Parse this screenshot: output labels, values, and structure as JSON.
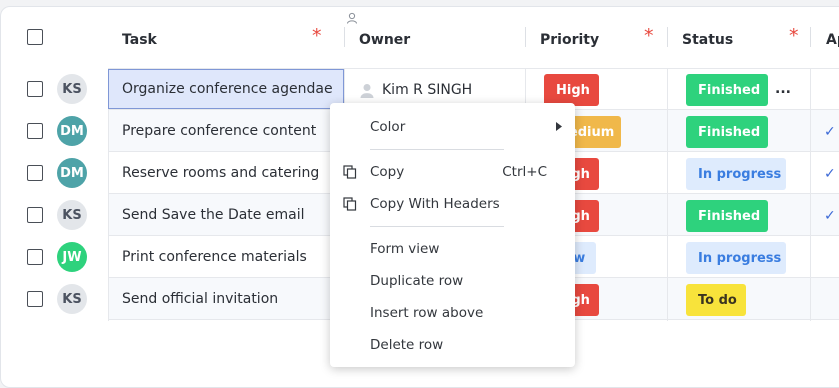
{
  "header": {
    "task": "Task",
    "owner": "Owner",
    "priority": "Priority",
    "status": "Status",
    "approved_partial": "Ap"
  },
  "rows": [
    {
      "initials": "KS",
      "avatar_bg": "#e3e6ea",
      "avatar_fg": "#4b5260",
      "task": "Organize conference agendae",
      "owner": "Kim R SINGH",
      "priority": "High",
      "priority_bg": "#e8493f",
      "priority_fg": "#ffffff",
      "status": "Finished",
      "status_bg": "#2ed27d",
      "status_fg": "#ffffff",
      "check": ""
    },
    {
      "initials": "DM",
      "avatar_bg": "#4ea3a8",
      "avatar_fg": "#ffffff",
      "task": "Prepare conference content",
      "owner": "",
      "priority": "Medium",
      "priority_bg": "#f0b84a",
      "priority_fg": "#ffffff",
      "status": "Finished",
      "status_bg": "#2ed27d",
      "status_fg": "#ffffff",
      "check": "✓"
    },
    {
      "initials": "DM",
      "avatar_bg": "#4ea3a8",
      "avatar_fg": "#ffffff",
      "task": "Reserve rooms and catering",
      "owner": "",
      "priority": "High",
      "priority_bg": "#e8493f",
      "priority_fg": "#ffffff",
      "status": "In progress",
      "status_bg": "#deebfd",
      "status_fg": "#3a7de0",
      "check": "✓"
    },
    {
      "initials": "KS",
      "avatar_bg": "#e3e6ea",
      "avatar_fg": "#4b5260",
      "task": "Send Save the Date email",
      "owner": "",
      "priority": "High",
      "priority_bg": "#e8493f",
      "priority_fg": "#ffffff",
      "status": "Finished",
      "status_bg": "#2ed27d",
      "status_fg": "#ffffff",
      "check": "✓"
    },
    {
      "initials": "JW",
      "avatar_bg": "#2ed27d",
      "avatar_fg": "#ffffff",
      "task": "Print conference materials",
      "owner": "",
      "priority": "Low",
      "priority_bg": "#deebfd",
      "priority_fg": "#3a7de0",
      "status": "In progress",
      "status_bg": "#deebfd",
      "status_fg": "#3a7de0",
      "check": ""
    },
    {
      "initials": "KS",
      "avatar_bg": "#e3e6ea",
      "avatar_fg": "#4b5260",
      "task": "Send official invitation",
      "owner": "",
      "priority": "High",
      "priority_bg": "#e8493f",
      "priority_fg": "#ffffff",
      "status": "To do",
      "status_bg": "#f8e33b",
      "status_fg": "#3a3420",
      "check": ""
    }
  ],
  "more_label": "...",
  "context_menu": {
    "color": "Color",
    "copy": "Copy",
    "copy_shortcut": "Ctrl+C",
    "copy_with_headers": "Copy With Headers",
    "form_view": "Form view",
    "duplicate_row": "Duplicate row",
    "insert_row_above": "Insert row above",
    "delete_row": "Delete row"
  },
  "colors": {
    "required_marker": "#e8493f",
    "selection_border": "#7f97d6",
    "check": "#3d6ad6"
  }
}
